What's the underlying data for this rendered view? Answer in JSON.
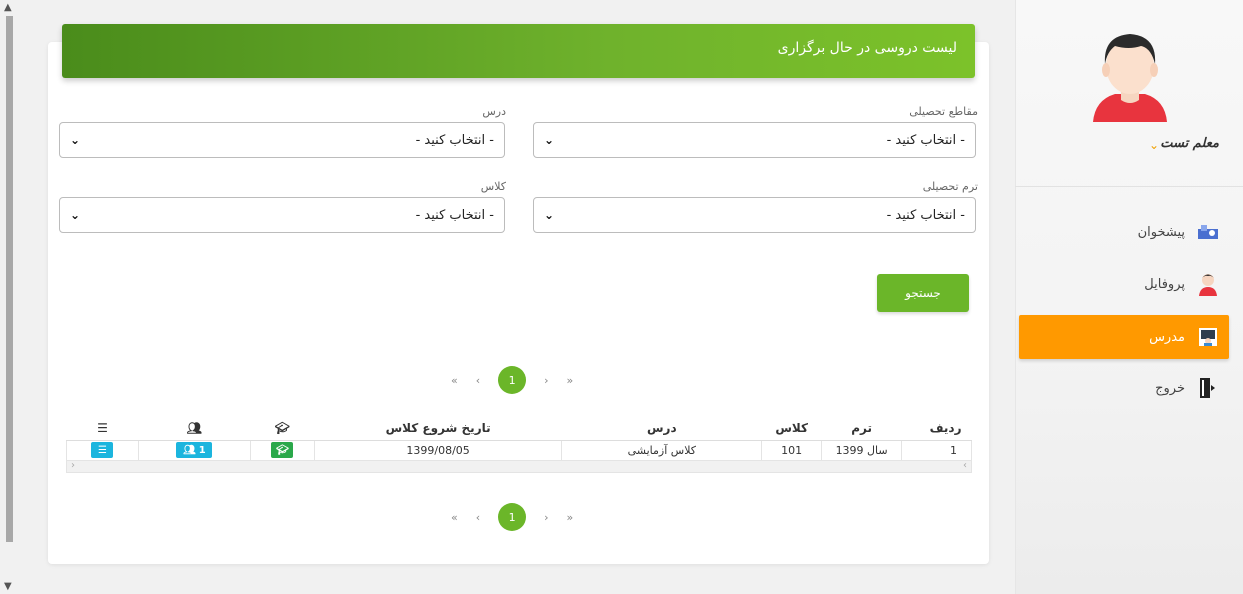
{
  "sidebar": {
    "user_name": "معلم تست",
    "items": [
      {
        "label": "پیشخوان",
        "icon": "dashboard-icon"
      },
      {
        "label": "پروفایل",
        "icon": "profile-icon"
      },
      {
        "label": "مدرس",
        "icon": "teacher-icon"
      },
      {
        "label": "خروج",
        "icon": "logout-icon"
      }
    ],
    "active_color": "#ff9900"
  },
  "card": {
    "title": "لیست دروسی در حال برگزاری",
    "header_color": "#6fb22c"
  },
  "filters": {
    "grade_label": "مقاطع تحصیلی",
    "lesson_label": "درس",
    "term_label": "ترم تحصیلی",
    "class_label": "کلاس",
    "placeholder": "- انتخاب کنید -",
    "search_button": "جستجو"
  },
  "pager": {
    "first": "«",
    "prev": "‹",
    "current": "1",
    "next": "›",
    "last": "»"
  },
  "table": {
    "headers": [
      "ردیف",
      "ترم",
      "کلاس",
      "درس",
      "تاریخ شروع کلاس"
    ],
    "rows": [
      {
        "index": "1",
        "term": "سال 1399",
        "class": "101",
        "lesson": "کلاس آزمایشی",
        "start_date": "1399/08/05",
        "students": "1"
      }
    ]
  }
}
